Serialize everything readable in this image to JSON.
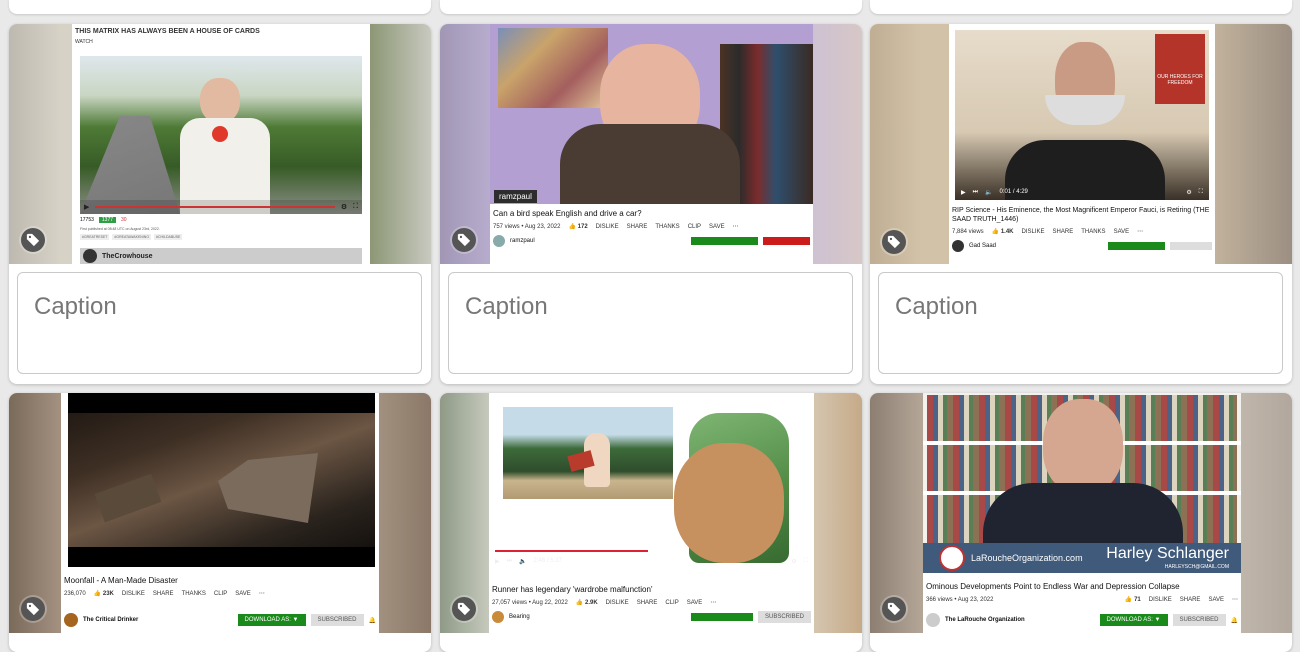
{
  "captions": {
    "placeholder": "Caption"
  },
  "cards": [
    {
      "title_banner": "THIS MATRIX HAS ALWAYS BEEN A HOUSE OF CARDS",
      "watch": "WATCH",
      "views": "17753",
      "likes": "1377",
      "dislikes": "30",
      "published": "First published at 08:48 UTC on August 23rd, 2022.",
      "tags": [
        "#GREATRESET",
        "#GREATAWAKENING",
        "#CHILDABUSE"
      ],
      "channel": "TheCrowhouse"
    },
    {
      "overlay_name": "ramzpaul",
      "title": "Can a bird speak English and drive a car?",
      "meta": "757 views • Aug 23, 2022",
      "likes": "172",
      "dislike": "DISLIKE",
      "share": "SHARE",
      "thanks": "THANKS",
      "clip": "CLIP",
      "save": "SAVE",
      "channel": "ramzpaul"
    },
    {
      "time": "0:01 / 4:29",
      "title": "RIP Science - His Eminence, the Most Magnificent Emperor Fauci, is Retiring (THE SAAD TRUTH_1446)",
      "meta": "7,884 views",
      "likes": "1.4K",
      "dislike": "DISLIKE",
      "share": "SHARE",
      "thanks": "THANKS",
      "save": "SAVE",
      "channel": "Gad Saad",
      "poster_text": "OUR HEROES FOR FREEDOM"
    },
    {
      "title": "Moonfall - A Man-Made Disaster",
      "meta": "236,070",
      "likes": "23K",
      "dislike": "DISLIKE",
      "share": "SHARE",
      "thanks": "THANKS",
      "clip": "CLIP",
      "save": "SAVE",
      "channel": "The Critical Drinker",
      "download": "DOWNLOAD AS: ▼",
      "subscribed": "SUBSCRIBED"
    },
    {
      "time": "2:46 / 5:37",
      "title": "Runner has legendary 'wardrobe malfunction'",
      "meta": "27,057 views • Aug 22, 2022",
      "likes": "2.9K",
      "dislike": "DISLIKE",
      "share": "SHARE",
      "clip": "CLIP",
      "save": "SAVE",
      "channel": "Bearing",
      "subscribed": "SUBSCRIBED"
    },
    {
      "org_site": "LaRoucheOrganization.com",
      "speaker": "Harley Schlanger",
      "email": "HARLEYSCH@GMAIL.COM",
      "title": "Ominous Developments Point to Endless War and Depression Collapse",
      "meta": "366 views • Aug 23, 2022",
      "likes": "71",
      "dislike": "DISLIKE",
      "share": "SHARE",
      "save": "SAVE",
      "channel": "The LaRouche Organization",
      "download": "DOWNLOAD AS: ▼",
      "subscribed": "SUBSCRIBED"
    }
  ]
}
